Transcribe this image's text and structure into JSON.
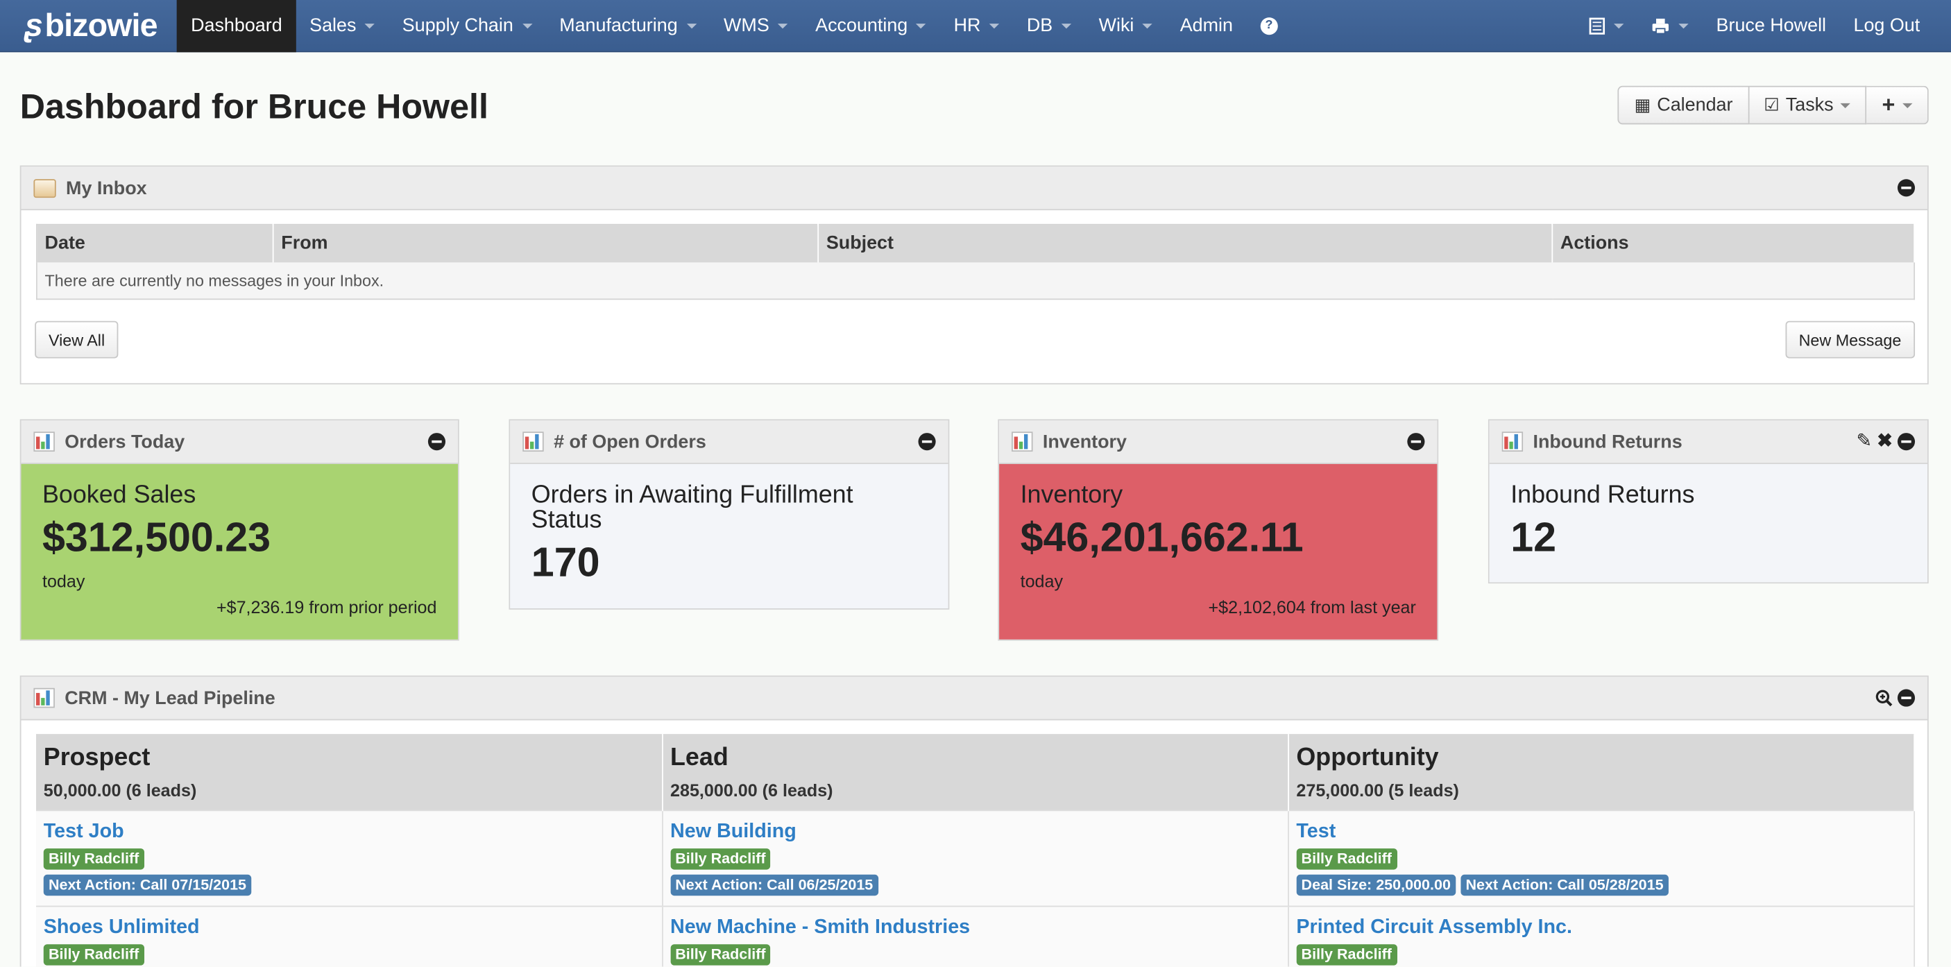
{
  "brand": {
    "name": "bizowie"
  },
  "nav": {
    "items": [
      {
        "label": "Dashboard",
        "active": true,
        "dropdown": false
      },
      {
        "label": "Sales",
        "dropdown": true
      },
      {
        "label": "Supply Chain",
        "dropdown": true
      },
      {
        "label": "Manufacturing",
        "dropdown": true
      },
      {
        "label": "WMS",
        "dropdown": true
      },
      {
        "label": "Accounting",
        "dropdown": true
      },
      {
        "label": "HR",
        "dropdown": true
      },
      {
        "label": "DB",
        "dropdown": true
      },
      {
        "label": "Wiki",
        "dropdown": true
      },
      {
        "label": "Admin",
        "dropdown": false
      }
    ],
    "help_icon": "?",
    "user_name": "Bruce Howell",
    "logout_label": "Log Out",
    "icons": [
      "document-icon",
      "printer-icon"
    ]
  },
  "header": {
    "title": "Dashboard for Bruce Howell",
    "calendar_label": "Calendar",
    "tasks_label": "Tasks"
  },
  "inbox": {
    "title": "My Inbox",
    "columns": [
      "Date",
      "From",
      "Subject",
      "Actions"
    ],
    "empty_message": "There are currently no messages in your Inbox.",
    "view_all_label": "View All",
    "new_message_label": "New Message"
  },
  "stats": {
    "orders_today": {
      "title": "Orders Today",
      "label": "Booked Sales",
      "value": "$312,500.23",
      "sub": "today",
      "change": "+$7,236.19 from prior period",
      "color": "#a9d371"
    },
    "open_orders": {
      "title": "# of Open Orders",
      "label": "Orders in Awaiting Fulfillment Status",
      "value": "170"
    },
    "inventory": {
      "title": "Inventory",
      "label": "Inventory",
      "value": "$46,201,662.11",
      "sub": "today",
      "change": "+$2,102,604 from last year",
      "color": "#dd5f68"
    },
    "inbound_returns": {
      "title": "Inbound Returns",
      "label": "Inbound Returns",
      "value": "12"
    }
  },
  "crm": {
    "title": "CRM - My Lead Pipeline",
    "columns": [
      {
        "stage": "Prospect",
        "total": "50,000.00 (6 leads)"
      },
      {
        "stage": "Lead",
        "total": "285,000.00 (6 leads)"
      },
      {
        "stage": "Opportunity",
        "total": "275,000.00 (5 leads)"
      }
    ],
    "rows": [
      [
        {
          "title": "Test Job",
          "owner": "Billy Radcliff",
          "tags": [
            "Next Action: Call 07/15/2015"
          ]
        },
        {
          "title": "New Building",
          "owner": "Billy Radcliff",
          "tags": [
            "Next Action: Call 06/25/2015"
          ]
        },
        {
          "title": "Test",
          "owner": "Billy Radcliff",
          "tags": [
            "Deal Size: 250,000.00",
            "Next Action: Call 05/28/2015"
          ]
        }
      ],
      [
        {
          "title": "Shoes Unlimited",
          "owner": "Billy Radcliff",
          "tags": []
        },
        {
          "title": "New Machine - Smith Industries",
          "owner": "Billy Radcliff",
          "tags": []
        },
        {
          "title": "Printed Circuit Assembly Inc.",
          "owner": "Billy Radcliff",
          "tags": []
        }
      ]
    ]
  }
}
